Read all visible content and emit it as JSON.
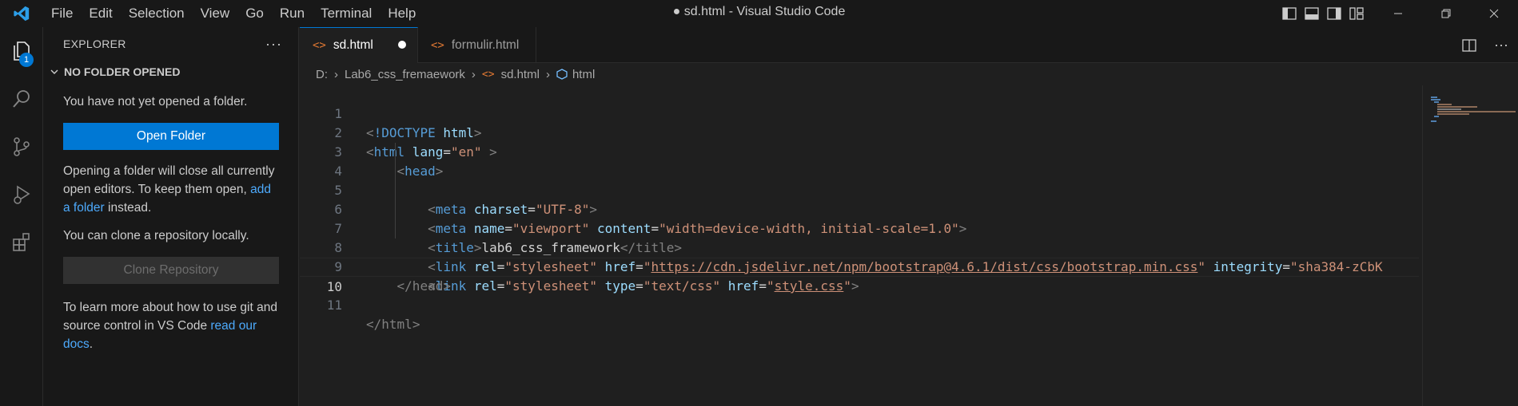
{
  "window": {
    "title": "● sd.html - Visual Studio Code"
  },
  "menu": [
    "File",
    "Edit",
    "Selection",
    "View",
    "Go",
    "Run",
    "Terminal",
    "Help"
  ],
  "activity_bar": {
    "explorer_badge": "1"
  },
  "sidebar": {
    "title": "EXPLORER",
    "more": "···",
    "section": "NO FOLDER OPENED",
    "intro": "You have not yet opened a folder.",
    "open_folder_button": "Open Folder",
    "open_note_prefix": "Opening a folder will close all currently open editors. To keep them open, ",
    "open_note_link": "add a folder",
    "open_note_suffix": " instead.",
    "clone_text": "You can clone a repository locally.",
    "clone_button": "Clone Repository",
    "learn_prefix": "To learn more about how to use git and source control in VS Code ",
    "learn_link": "read our docs",
    "learn_suffix": "."
  },
  "tabs": [
    {
      "label": "sd.html",
      "icon": "<>",
      "active": true
    },
    {
      "label": "formulir.html",
      "icon": "<>",
      "active": false
    }
  ],
  "tab_more": "···",
  "breadcrumb": {
    "drive": "D:",
    "folder": "Lab6_css_fremaework",
    "file": "sd.html",
    "symbol": "html"
  },
  "code": {
    "lines": [
      {
        "n": "1",
        "indent": 0
      },
      {
        "n": "2",
        "indent": 0
      },
      {
        "n": "3",
        "indent": 1
      },
      {
        "n": "4",
        "indent": 2
      },
      {
        "n": "5",
        "indent": 2
      },
      {
        "n": "6",
        "indent": 2
      },
      {
        "n": "7",
        "indent": 2
      },
      {
        "n": "8",
        "indent": 2
      },
      {
        "n": "9",
        "indent": 1
      },
      {
        "n": "10",
        "indent": 0
      },
      {
        "n": "11",
        "indent": 0
      }
    ],
    "tokens": {
      "l1_doctype": "!DOCTYPE",
      "l1_html": " html",
      "l2_tag": "html",
      "l2_attr": " lang",
      "l2_val": "\"en\"",
      "l3_tag": "head",
      "l4_tag": "meta",
      "l4_attr": " charset",
      "l4_val": "\"UTF-8\"",
      "l5_tag": "meta",
      "l5_attr1": " name",
      "l5_val1": "\"viewport\"",
      "l5_attr2": " content",
      "l5_val2": "\"width=device-width, initial-scale=1.0\"",
      "l6_tag": "title",
      "l6_text": "lab6_css_framework",
      "l6_close": "/title",
      "l7_tag": "link",
      "l7_attr1": " rel",
      "l7_val1": "\"stylesheet\"",
      "l7_attr2": " href",
      "l7_q1": "\"",
      "l7_url": "https://cdn.jsdelivr.net/npm/bootstrap@4.6.1/dist/css/bootstrap.min.css",
      "l7_q2": "\"",
      "l7_attr3": " integrity",
      "l7_val3": "\"sha384-zCbK",
      "l8_tag": "link",
      "l8_attr1": " rel",
      "l8_val1": "\"stylesheet\"",
      "l8_attr2": " type",
      "l8_val2": "\"text/css\"",
      "l8_attr3": " href",
      "l8_q1": "\"",
      "l8_url": "style.css",
      "l8_q2": "\"",
      "l9_close": "/head",
      "l11_close": "/html"
    }
  },
  "colors": {
    "accent": "#0078d4",
    "tag": "#569cd6",
    "attr": "#9cdcfe",
    "string": "#ce9178",
    "html_icon": "#e37933"
  }
}
